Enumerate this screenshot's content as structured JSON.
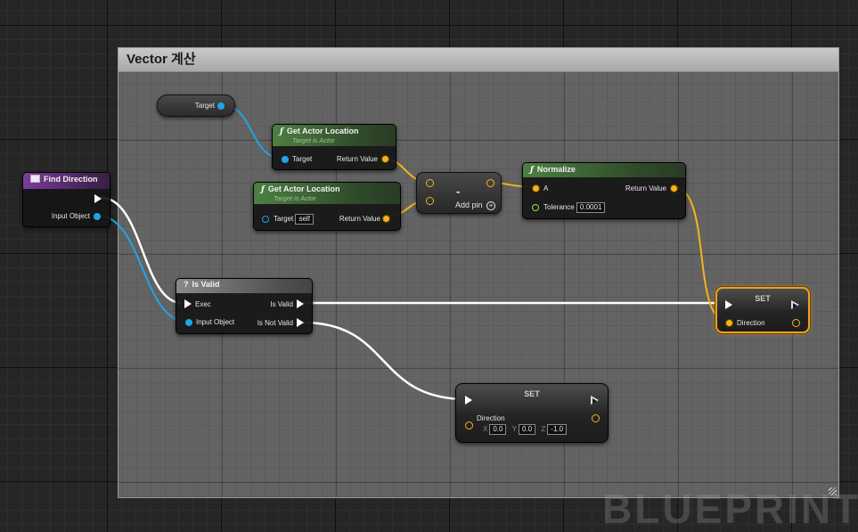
{
  "comment": {
    "title": "Vector 계산"
  },
  "watermark": "BLUEPRINT",
  "target_reroute": {
    "label": "Target"
  },
  "get_actor_location_1": {
    "title": "Get Actor Location",
    "subtitle": "Target is Actor",
    "in_label": "Target",
    "out_label": "Return Value"
  },
  "get_actor_location_2": {
    "title": "Get Actor Location",
    "subtitle": "Target is Actor",
    "in_label": "Target",
    "in_value": "self",
    "out_label": "Return Value"
  },
  "subtract": {
    "symbol": "-",
    "add_pin_label": "Add pin"
  },
  "normalize": {
    "title": "Normalize",
    "in_label": "A",
    "tolerance_label": "Tolerance",
    "tolerance_value": "0.0001",
    "out_label": "Return Value"
  },
  "find_direction": {
    "title": "Find Direction",
    "out_label": "Input Object"
  },
  "is_valid": {
    "icon": "?",
    "title": "Is Valid",
    "exec_label": "Exec",
    "input_label": "Input Object",
    "valid_label": "Is Valid",
    "not_valid_label": "Is Not Valid"
  },
  "set_1": {
    "title": "SET",
    "var_label": "Direction"
  },
  "set_2": {
    "title": "SET",
    "var_label": "Direction",
    "x_label": "X",
    "x_value": "0.0",
    "y_label": "Y",
    "y_value": "0.0",
    "z_label": "Z",
    "z_value": "-1.0"
  },
  "colors": {
    "exec": "#ffffff",
    "object": "#1fa5e6",
    "vector": "#f7b21b",
    "float": "#8fe05a",
    "selected": "#f0a020"
  }
}
